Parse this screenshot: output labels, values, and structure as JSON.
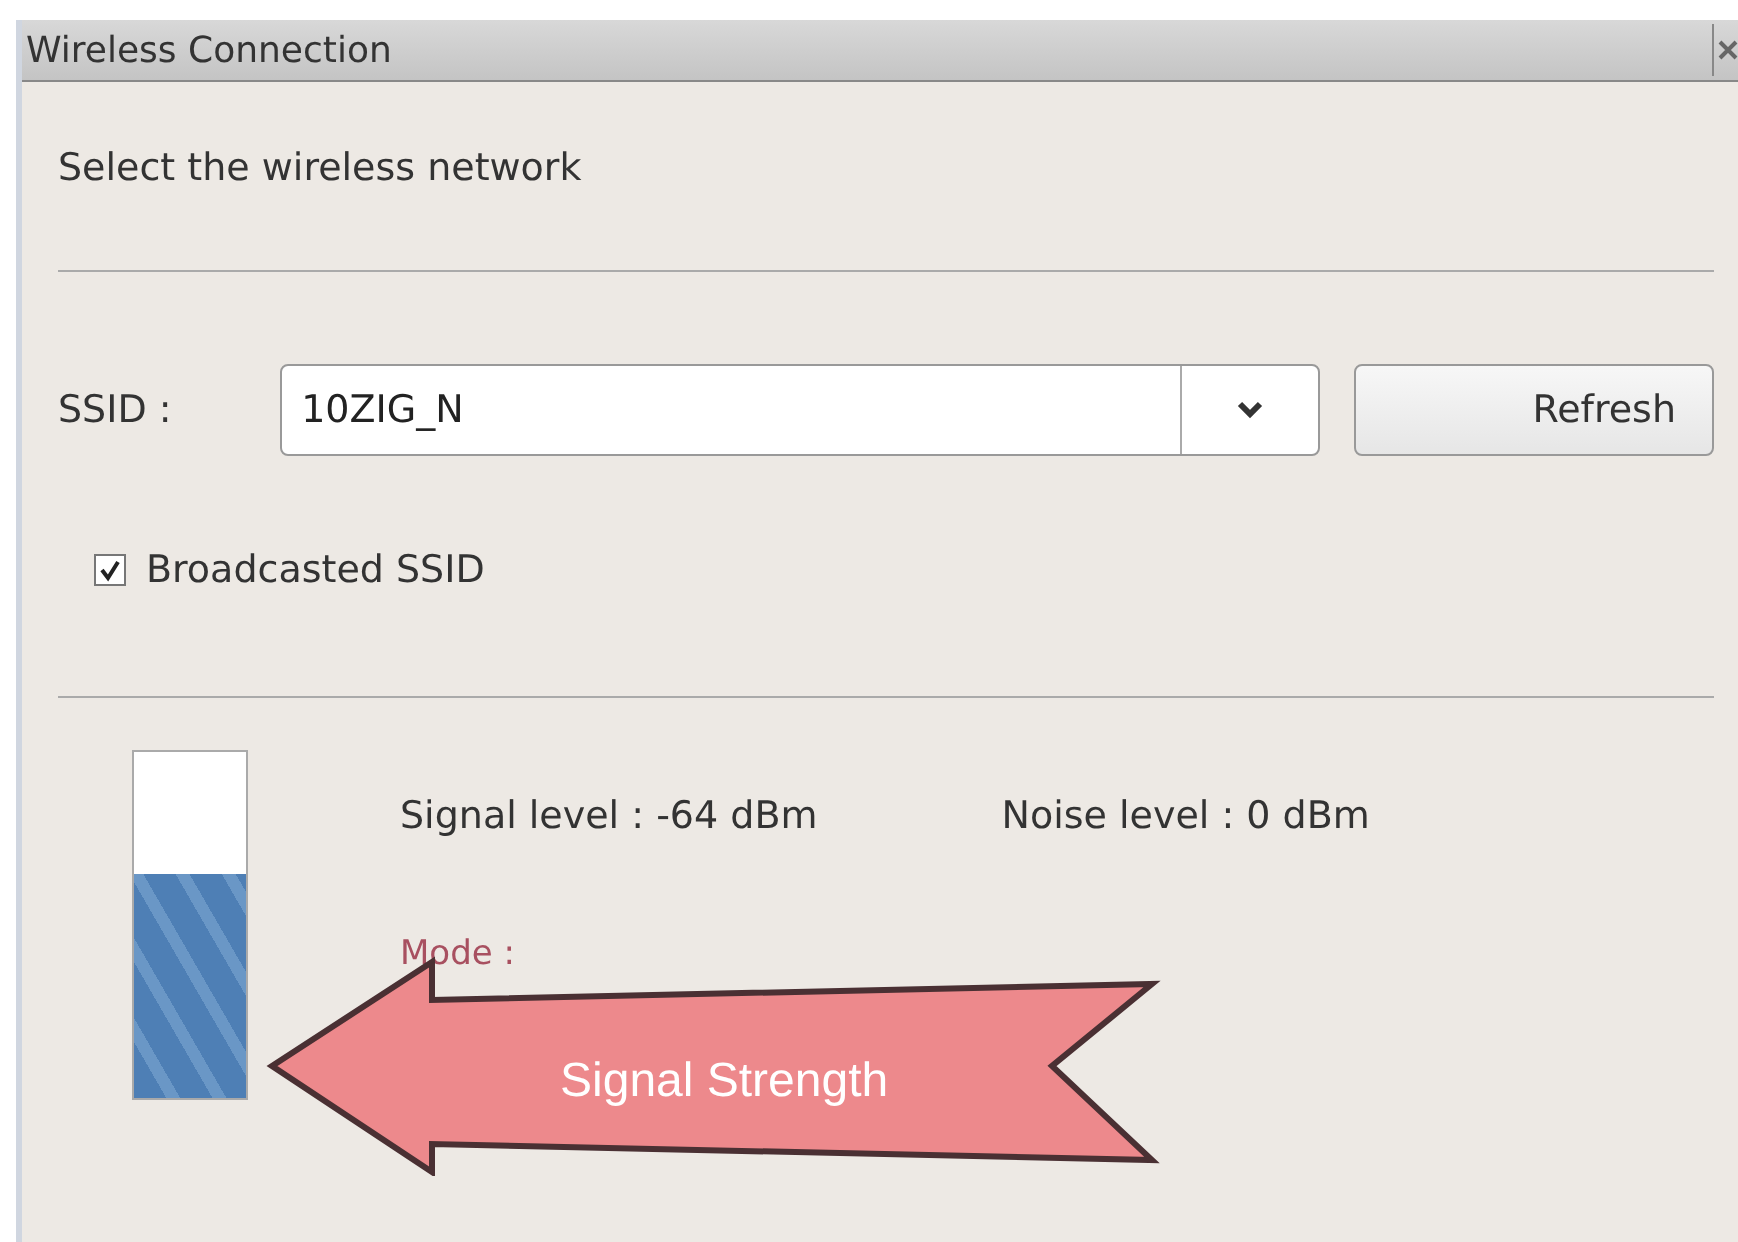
{
  "window": {
    "title": "Wireless Connection"
  },
  "prompt": "Select the wireless network",
  "ssid": {
    "label": "SSID :",
    "value": "10ZIG_N"
  },
  "refresh_button": "Refresh",
  "broadcasted": {
    "label": "Broadcasted SSID",
    "checked": true
  },
  "signal": {
    "level": 0.65,
    "signal_text": "Signal level : -64 dBm",
    "noise_text": "Noise level : 0 dBm",
    "mode_text": "Mode :"
  },
  "annotation": {
    "text": "Signal Strength"
  }
}
